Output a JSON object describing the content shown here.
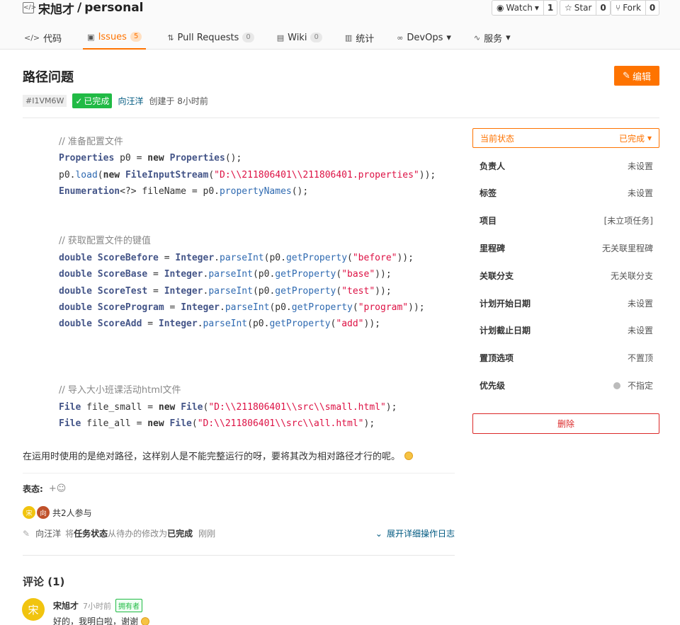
{
  "repo": {
    "owner": "宋旭才",
    "separator": "/",
    "name": "personal"
  },
  "actions": {
    "watch": {
      "label": "Watch",
      "count": "1",
      "caret": "▾"
    },
    "star": {
      "label": "Star",
      "count": "0"
    },
    "fork": {
      "label": "Fork",
      "count": "0"
    }
  },
  "tabs": [
    {
      "label": "代码"
    },
    {
      "label": "Issues",
      "badge": "5"
    },
    {
      "label": "Pull Requests",
      "badge": "0"
    },
    {
      "label": "Wiki",
      "badge": "0"
    },
    {
      "label": "统计"
    },
    {
      "label": "DevOps",
      "caret": "▾"
    },
    {
      "label": "服务",
      "caret": "▾"
    }
  ],
  "issue": {
    "title": "路径问题",
    "edit_label": "编辑",
    "id": "#I1VM6W",
    "status": "已完成",
    "author": "向汪洋",
    "created": "创建于 8小时前"
  },
  "code": {
    "c1": "// 准备配置文件",
    "c2": "// 获取配置文件的键值",
    "c3": "// 导入大小班课活动html文件",
    "s_path1": "\"D:\\\\211806401\\\\211806401.properties\"",
    "s_before": "\"before\"",
    "s_base": "\"base\"",
    "s_test": "\"test\"",
    "s_program": "\"program\"",
    "s_add": "\"add\"",
    "s_small": "\"D:\\\\211806401\\\\src\\\\small.html\"",
    "s_all": "\"D:\\\\211806401\\\\src\\\\all.html\""
  },
  "body_text": "在运用时使用的是绝对路径，这样别人是不能完整运行的呀，要将其改为相对路径才行的呢。",
  "reactions": {
    "label": "表态:",
    "add": "+☺"
  },
  "participants": {
    "avatar1": "宋",
    "avatar2": "向",
    "text": "共2人参与"
  },
  "activity": {
    "who": "向汪洋",
    "pre": "将",
    "field": "任务状态",
    "mid": "从待办的修改为",
    "to": "已完成",
    "time": "刚刚",
    "expand": "展开详细操作日志"
  },
  "comments": {
    "title": "评论 (1)",
    "items": [
      {
        "avatar": "宋",
        "name": "宋旭才",
        "time": "7小时前",
        "role": "拥有者",
        "text": "好的，我明白啦，谢谢"
      }
    ]
  },
  "sidebar": {
    "state_label": "当前状态",
    "state_value": "已完成",
    "rows": [
      {
        "label": "负责人",
        "value": "未设置"
      },
      {
        "label": "标签",
        "value": "未设置"
      },
      {
        "label": "项目",
        "value": "[未立项任务]"
      },
      {
        "label": "里程碑",
        "value": "无关联里程碑"
      },
      {
        "label": "关联分支",
        "value": "无关联分支"
      },
      {
        "label": "计划开始日期",
        "value": "未设置"
      },
      {
        "label": "计划截止日期",
        "value": "未设置"
      },
      {
        "label": "置顶选项",
        "value": "不置顶"
      },
      {
        "label": "优先级",
        "value": "不指定"
      }
    ],
    "delete_label": "删除"
  },
  "colors": {
    "accent": "#fe7300",
    "success": "#21ba45",
    "danger": "#db2828",
    "link": "#005980"
  }
}
